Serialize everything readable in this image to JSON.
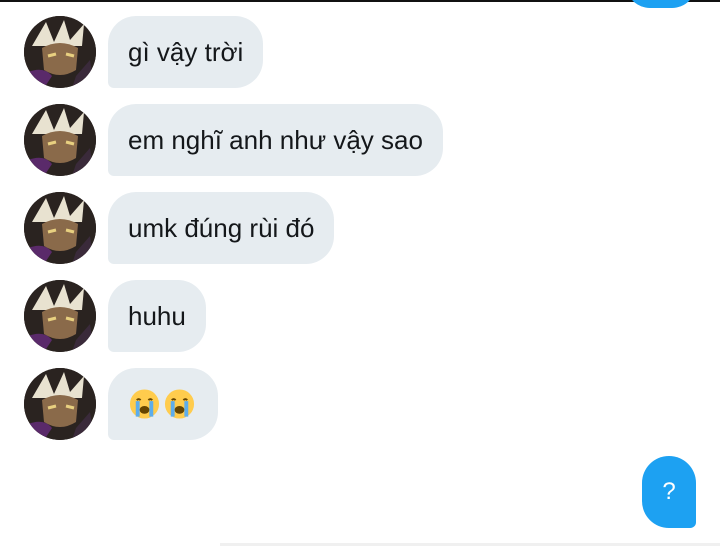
{
  "messages": [
    {
      "sender": "other",
      "text": "gì vậy trời"
    },
    {
      "sender": "other",
      "text": "em nghĩ anh như vậy sao"
    },
    {
      "sender": "other",
      "text": "umk đúng rùi đó"
    },
    {
      "sender": "other",
      "text": "huhu"
    },
    {
      "sender": "other",
      "emoji": [
        "loudly-crying-face",
        "loudly-crying-face"
      ]
    },
    {
      "sender": "me",
      "text": "?"
    }
  ],
  "colors": {
    "received_bubble": "#e6ecf0",
    "sent_bubble": "#1da1f2",
    "text_dark": "#14171a",
    "text_light": "#ffffff"
  }
}
